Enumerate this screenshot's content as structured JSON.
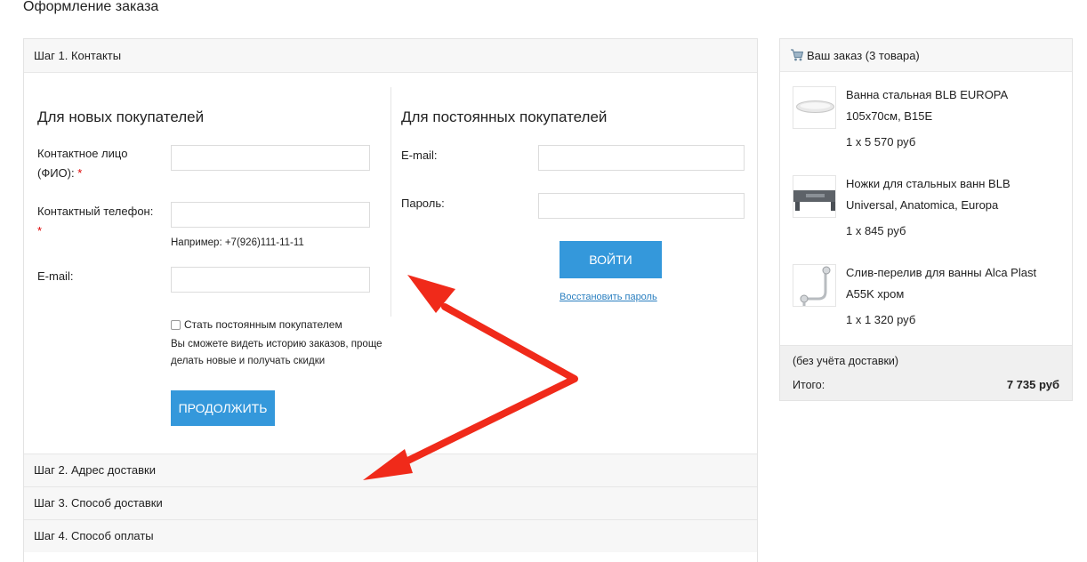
{
  "page_title": "Оформление заказа",
  "steps": {
    "step1": "Шаг 1. Контакты",
    "step2": "Шаг 2. Адрес доставки",
    "step3": "Шаг 3. Способ доставки",
    "step4": "Шаг 4. Способ оплаты"
  },
  "new_customers": {
    "title": "Для новых покупателей",
    "contact_label_line1": "Контактное лицо",
    "contact_label_line2": "(ФИО):",
    "phone_label": "Контактный телефон:",
    "phone_hint": "Например: +7(926)111-11-11",
    "email_label": "E-mail:",
    "required_mark": "*",
    "checkbox_label": "Стать постоянным покупателем",
    "checkbox_note": "Вы сможете видеть историю заказов, проще делать новые и получать скидки",
    "continue_button": "ПРОДОЛЖИТЬ"
  },
  "returning_customers": {
    "title": "Для постоянных покупателей",
    "email_label": "E-mail:",
    "password_label": "Пароль:",
    "login_button": "ВОЙТИ",
    "restore_link": "Восстановить пароль"
  },
  "order": {
    "title": "Ваш заказ (3 товара)",
    "items": [
      {
        "name": "Ванна стальная BLB EUROPA 105x70см, B15E",
        "qty_price": "1 x 5 570 руб"
      },
      {
        "name": "Ножки для стальных ванн BLB Universal, Anatomica, Europa",
        "qty_price": "1 x 845 руб"
      },
      {
        "name": "Слив-перелив для ванны Alca Plast A55K хром",
        "qty_price": "1 x 1 320 руб"
      }
    ],
    "delivery_note": "(без учёта доставки)",
    "total_label": "Итого:",
    "total_value": "7 735 руб"
  },
  "colors": {
    "button_blue": "#3498db",
    "link_blue": "#2a7fc0",
    "required_red": "#dd0000",
    "annotation_arrow": "#f02a1a"
  },
  "icons": {
    "cart": "cart-icon",
    "bathtub_thumb": "bathtub-image",
    "legs_thumb": "bath-legs-image",
    "drain_thumb": "drain-overflow-image"
  }
}
